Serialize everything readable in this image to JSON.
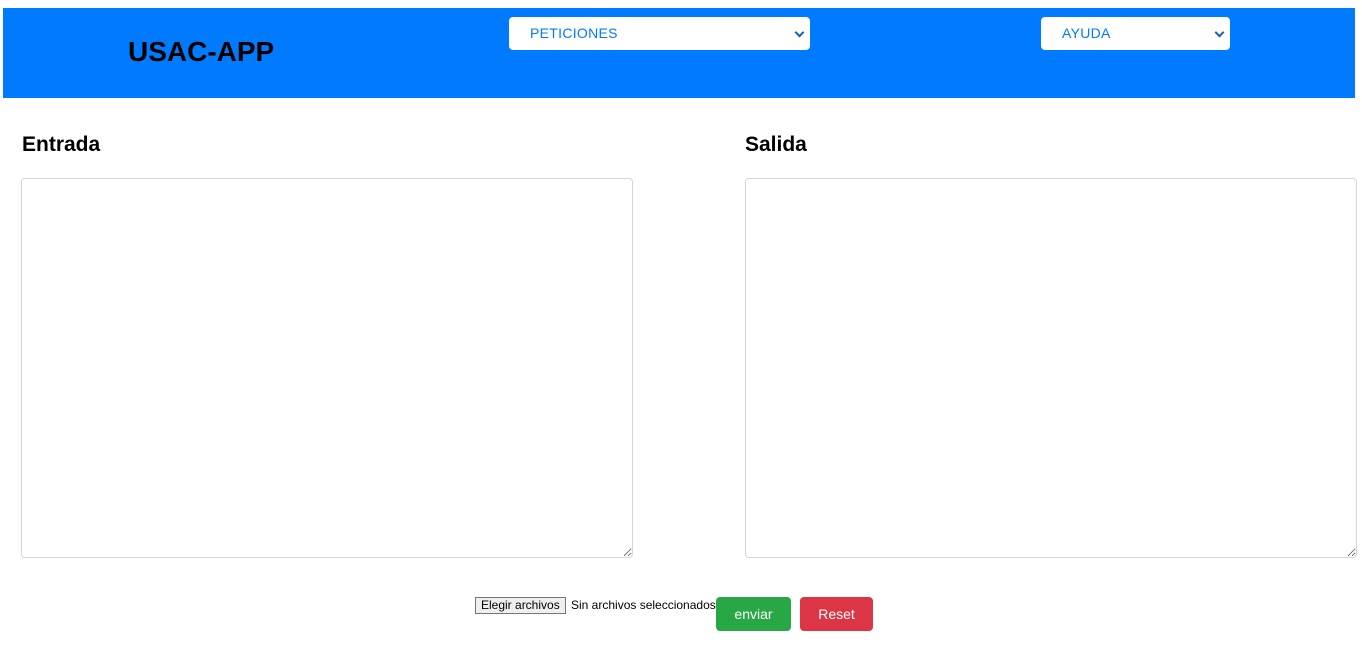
{
  "header": {
    "title": "USAC-APP",
    "peticiones_select": "PETICIONES",
    "ayuda_select": "AYUDA"
  },
  "main": {
    "entrada_title": "Entrada",
    "salida_title": "Salida",
    "entrada_value": "",
    "salida_value": ""
  },
  "footer": {
    "file_button_label": "Elegir archivos",
    "file_status": "Sin archivos seleccionados",
    "enviar_label": "enviar",
    "reset_label": "Reset"
  },
  "colors": {
    "header_bg": "#007bff",
    "enviar_bg": "#28a745",
    "reset_bg": "#dc3545"
  }
}
